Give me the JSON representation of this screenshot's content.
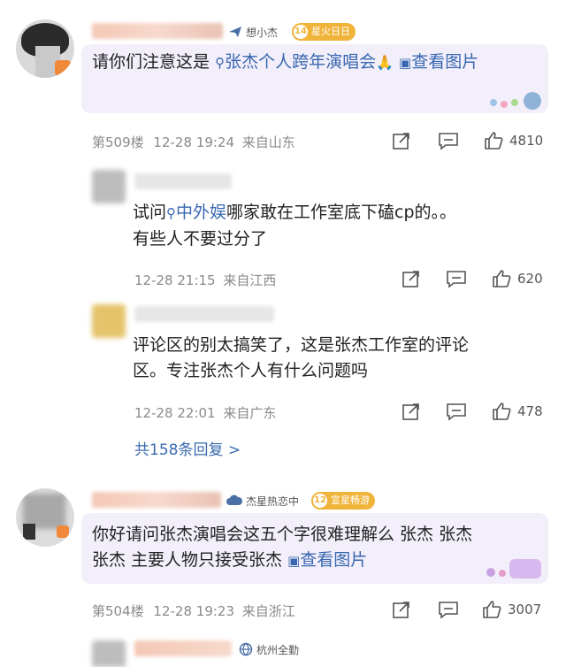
{
  "comments": [
    {
      "author_badge": "想小杰",
      "level": "14",
      "level_title": "星火日日",
      "text_prefix": "请你们注意这是",
      "topic": "张杰个人跨年演唱会",
      "emoji": "🙏",
      "view_image": "查看图片",
      "view_image_wrap": "图片",
      "floor": "第509楼",
      "time": "12-28 19:24",
      "location": "来自山东",
      "likes": "4810"
    },
    {
      "text_a": "试问",
      "topic": "中外娱",
      "text_b": "哪家敢在工作室底下磕cp的。。",
      "text_c": "有些人不要过分了",
      "time": "12-28 21:15",
      "location": "来自江西",
      "likes": "620"
    },
    {
      "text_a": "评论区的别太搞笑了，这是张杰工作室的评论",
      "text_b": "区。专注张杰个人有什么问题吗",
      "time": "12-28 22:01",
      "location": "来自广东",
      "likes": "478"
    },
    {
      "author_badge": "杰星热恋中",
      "level": "12",
      "level_title": "宣星畅游",
      "text_a": "你好请问张杰演唱会这五个字很难理解么 张杰 张杰",
      "text_b": "张杰 主要人物只接受张杰",
      "view_image": "查看图片",
      "floor": "第504楼",
      "time": "12-28 19:23",
      "location": "来自浙江",
      "likes": "3007"
    },
    {
      "author_badge": "杭州全勤"
    }
  ],
  "replies_link": "共158条回复 >",
  "colors": {
    "link": "#3867b0",
    "bubble": "#f3effa",
    "meta": "#8a8a8a"
  }
}
